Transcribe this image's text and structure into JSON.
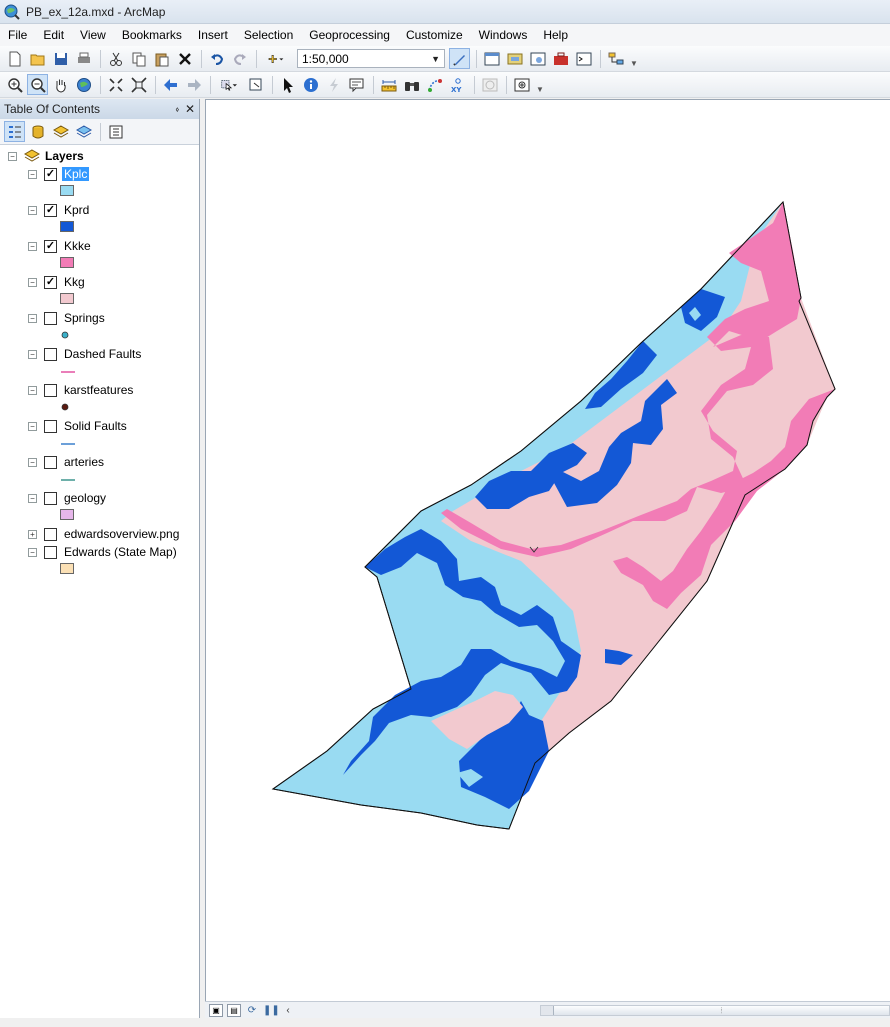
{
  "window": {
    "title": "PB_ex_12a.mxd - ArcMap",
    "icon": "arcmap-globe-icon"
  },
  "menu": [
    "File",
    "Edit",
    "View",
    "Bookmarks",
    "Insert",
    "Selection",
    "Geoprocessing",
    "Customize",
    "Windows",
    "Help"
  ],
  "toolbar": {
    "scale_value": "1:50,000"
  },
  "toc": {
    "title": "Table Of Contents",
    "pin_glyph": "⬫",
    "close_glyph": "✕",
    "root": "Layers",
    "layers": [
      {
        "name": "Kplc",
        "checked": true,
        "selected": true,
        "symbol": "fill",
        "color": "#99dbf2"
      },
      {
        "name": "Kprd",
        "checked": true,
        "selected": false,
        "symbol": "fill",
        "color": "#1358d6"
      },
      {
        "name": "Kkke",
        "checked": true,
        "selected": false,
        "symbol": "fill",
        "color": "#f27cb6"
      },
      {
        "name": "Kkg",
        "checked": true,
        "selected": false,
        "symbol": "fill",
        "color": "#f2c9cf"
      },
      {
        "name": "Springs",
        "checked": false,
        "selected": false,
        "symbol": "point",
        "color": "#3bb0c9"
      },
      {
        "name": "Dashed Faults",
        "checked": false,
        "selected": false,
        "symbol": "line",
        "color": "#e0479b"
      },
      {
        "name": "karstfeatures",
        "checked": false,
        "selected": false,
        "symbol": "point",
        "color": "#5a1a10"
      },
      {
        "name": "Solid Faults",
        "checked": false,
        "selected": false,
        "symbol": "line",
        "color": "#2e78c9"
      },
      {
        "name": "arteries",
        "checked": false,
        "selected": false,
        "symbol": "line",
        "color": "#2f8f86"
      },
      {
        "name": "geology",
        "checked": false,
        "selected": false,
        "symbol": "fill",
        "color": "#e6b6ea"
      },
      {
        "name": "edwardsoverview.png",
        "checked": false,
        "selected": false,
        "symbol": "none",
        "color": ""
      },
      {
        "name": "Edwards (State Map)",
        "checked": false,
        "selected": false,
        "symbol": "fill",
        "color": "#fbe0b5"
      }
    ]
  },
  "map": {
    "colors": {
      "kplc": "#99dbf2",
      "kprd": "#1358d6",
      "kkke": "#f27cb6",
      "kkg": "#f2c9cf",
      "outline": "#111111"
    }
  }
}
